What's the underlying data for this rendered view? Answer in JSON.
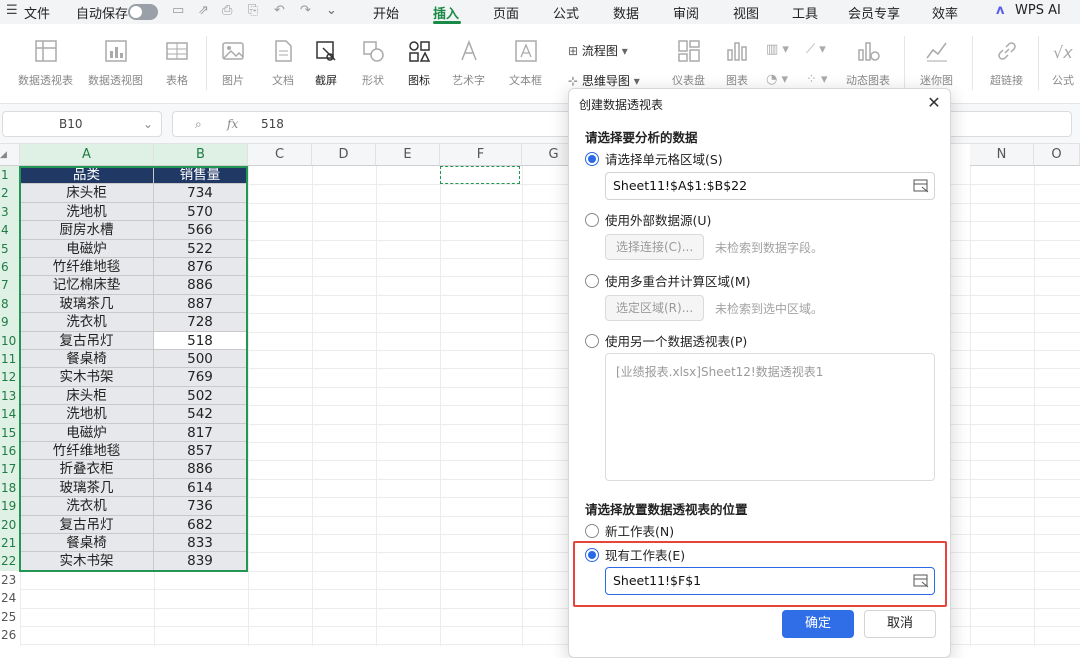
{
  "menubar": {
    "file": "文件",
    "autosave": "自动保存",
    "tabs": [
      "开始",
      "插入",
      "页面",
      "公式",
      "数据",
      "审阅",
      "视图",
      "工具",
      "会员专享",
      "效率"
    ],
    "active_tab": "插入",
    "ai": "WPS AI"
  },
  "ribbon": {
    "pivot_table": "数据透视表",
    "pivot_chart": "数据透视图",
    "table": "表格",
    "picture": "图片",
    "document": "文档",
    "screenshot": "截屏",
    "shape": "形状",
    "icon": "图标",
    "wordart": "艺术字",
    "textbox": "文本框",
    "flowchart": "流程图",
    "mindmap": "思维导图",
    "dashboard": "仪表盘",
    "chart": "图表",
    "dynamic_chart": "动态图表",
    "sparkline": "迷你图",
    "hyperlink": "超链接",
    "formula": "公式"
  },
  "formula_bar": {
    "name_box": "B10",
    "fx": "fx",
    "value": "518"
  },
  "grid": {
    "columns": [
      "A",
      "B",
      "C",
      "D",
      "E",
      "F",
      "G",
      "N",
      "O"
    ],
    "rows": [
      "1",
      "2",
      "3",
      "4",
      "5",
      "6",
      "7",
      "8",
      "9",
      "10",
      "11",
      "12",
      "13",
      "14",
      "15",
      "16",
      "17",
      "18",
      "19",
      "20",
      "21",
      "22",
      "23",
      "24",
      "25",
      "26"
    ],
    "header": [
      "品类",
      "销售量"
    ],
    "data": [
      [
        "床头柜",
        "734"
      ],
      [
        "洗地机",
        "570"
      ],
      [
        "厨房水槽",
        "566"
      ],
      [
        "电磁炉",
        "522"
      ],
      [
        "竹纤维地毯",
        "876"
      ],
      [
        "记忆棉床垫",
        "886"
      ],
      [
        "玻璃茶几",
        "887"
      ],
      [
        "洗衣机",
        "728"
      ],
      [
        "复古吊灯",
        "518"
      ],
      [
        "餐桌椅",
        "500"
      ],
      [
        "实木书架",
        "769"
      ],
      [
        "床头柜",
        "502"
      ],
      [
        "洗地机",
        "542"
      ],
      [
        "电磁炉",
        "817"
      ],
      [
        "竹纤维地毯",
        "857"
      ],
      [
        "折叠衣柜",
        "886"
      ],
      [
        "玻璃茶几",
        "614"
      ],
      [
        "洗衣机",
        "736"
      ],
      [
        "复古吊灯",
        "682"
      ],
      [
        "餐桌椅",
        "833"
      ],
      [
        "实木书架",
        "839"
      ]
    ]
  },
  "dialog": {
    "title": "创建数据透视表",
    "section1": "请选择要分析的数据",
    "opt_range": "请选择单元格区域(S)",
    "range_value": "Sheet11!$A$1:$B$22",
    "opt_external": "使用外部数据源(U)",
    "choose_conn": "选择连接(C)...",
    "no_fields": "未检索到数据字段。",
    "opt_multi": "使用多重合并计算区域(M)",
    "select_region": "选定区域(R)...",
    "no_region": "未检索到选中区域。",
    "opt_another": "使用另一个数据透视表(P)",
    "another_value": "[业绩报表.xlsx]Sheet12!数据透视表1",
    "section2": "请选择放置数据透视表的位置",
    "opt_new": "新工作表(N)",
    "opt_existing": "现有工作表(E)",
    "existing_value": "Sheet11!$F$1",
    "ok": "确定",
    "cancel": "取消"
  }
}
